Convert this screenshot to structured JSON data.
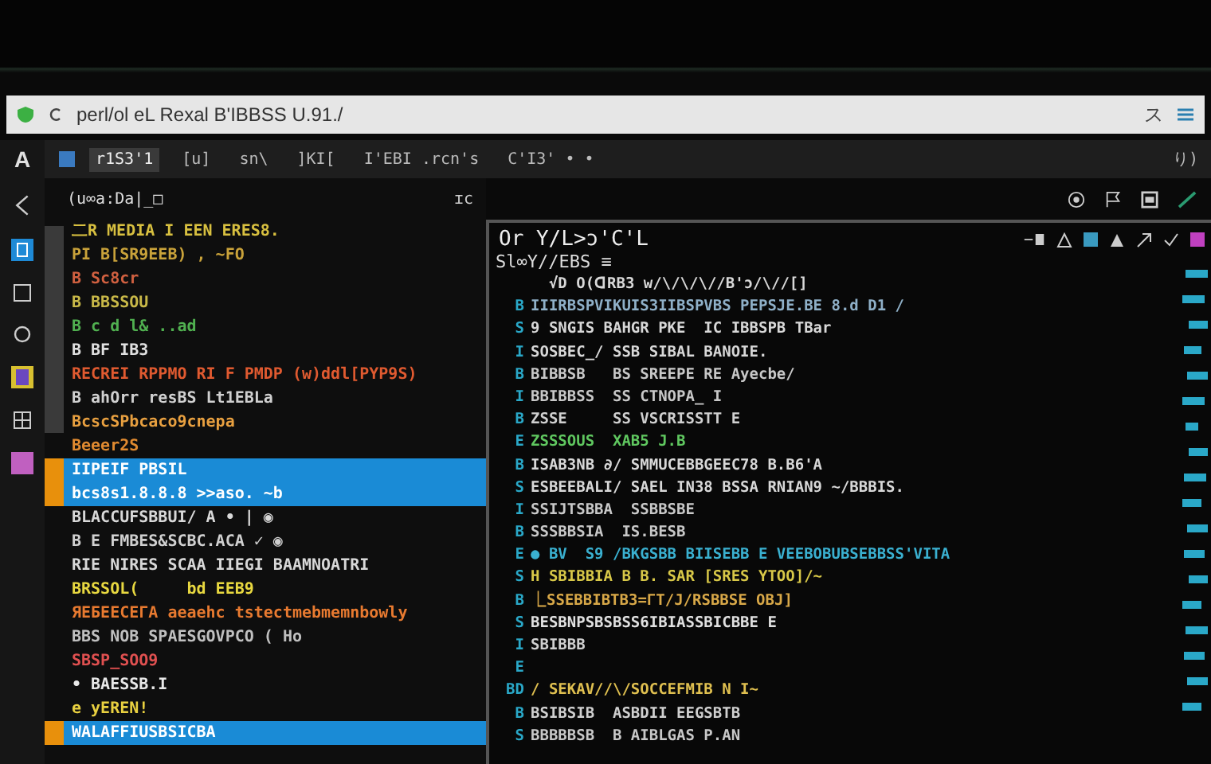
{
  "window": {
    "logo": "A"
  },
  "address_bar": {
    "url": "perl/ol eL Rexal B'IBBSS U.91./",
    "suffix": "ス"
  },
  "toolbar": {
    "items": [
      {
        "label": "r1S3'1",
        "selected": true
      },
      {
        "label": "[u]",
        "selected": false
      },
      {
        "label": "sn\\",
        "selected": false
      },
      {
        "label": "]KI[",
        "selected": false
      },
      {
        "label": "I'EBI .rcn's",
        "selected": false
      },
      {
        "label": "C'I3' • •",
        "selected": false
      }
    ],
    "right": "り)"
  },
  "sidebar": {
    "header": "(u∞a:Da|_□",
    "badge": "ɪc",
    "rows": [
      {
        "text": "二R MEDIA I EEN ERES8.",
        "color": "#d8c040",
        "selected": false
      },
      {
        "text": "PI B[SR9EEB) , ~FO",
        "color": "#c9a23a",
        "selected": false
      },
      {
        "text": "B Sc8cr",
        "color": "#d06040",
        "selected": false
      },
      {
        "text": "B BBSSOU",
        "color": "#c8b848",
        "selected": false
      },
      {
        "text": "B c d l& ..ad",
        "color": "#50b050",
        "selected": false
      },
      {
        "text": "B BF IB3",
        "color": "#e0e0e0",
        "selected": false
      },
      {
        "text": "RECREI RPPMO RI F PMDP (w)ddl[PYP9S)",
        "color": "#e05a30",
        "selected": false
      },
      {
        "text": "B ahOrr resBS Lt1EBLa",
        "color": "#d0d0d0",
        "selected": false
      },
      {
        "text": "BcscSPbcaco9cnepa",
        "color": "#e8a040",
        "selected": false
      },
      {
        "text": "Beeer2S",
        "color": "#e08a30",
        "selected": false
      },
      {
        "text": "IIPEIF PBSIL",
        "selected": true
      },
      {
        "text": "bcs8s1.8.8.8 >>aso. ~b",
        "selected": true
      },
      {
        "text": "BLACCUFSBBUI/ A • | ◉",
        "color": "#d8d8d8",
        "selected": false
      },
      {
        "text": "B E FMBES&SCBC.ACA ✓ ◉",
        "color": "#d0d0d0",
        "selected": false
      },
      {
        "text": "RIE NIRES SCAA IIEGI BAAMNOATRI",
        "color": "#d8d8d8",
        "selected": false
      },
      {
        "text": "BRSSOL(     bd EEB9",
        "color": "#e8d840",
        "selected": false
      },
      {
        "text": "ЯEБEECEГA aeaehc tstectmebmemnbowly",
        "color": "#e87a30",
        "selected": false
      },
      {
        "text": "BBS NOB SPAESGOVPCO ( Ho",
        "color": "#c0c0c0",
        "selected": false
      },
      {
        "text": "SBSP_SOO9",
        "color": "#e05050",
        "selected": false
      },
      {
        "text": "• BAESSB.I",
        "color": "#e8e8e8",
        "selected": false
      },
      {
        "text": "e yEREN!",
        "color": "#e8d040",
        "selected": false
      },
      {
        "text": "WALAFFIUSBSICBA",
        "selected": true
      }
    ]
  },
  "editor": {
    "title": "Or Y/L>ɔ'C'L",
    "subtitle": "Sl∞Y//EBS ≡",
    "lines": [
      {
        "text": "  √D O(ꓷRB3 w/\\/\\/\\//B'ɔ/\\/∕[]",
        "color": "#d8d8d8"
      },
      {
        "gutter": "B",
        "text": "IIIRBSPVIKUIS3IIBSPVBS PEPSJE.BE 8.d D1 ∕",
        "color": "#8fb0c8"
      },
      {
        "gutter": "S",
        "text": "9 SNGIS BAHGR PKE  IC IBBSPB TBar",
        "color": "#d8d8d8"
      },
      {
        "gutter": "I",
        "text": "SOSBEC_/ SSB SIBAL BANOIE.",
        "color": "#d8d8d8"
      },
      {
        "gutter": "B",
        "text": "BIBBSB   BS SREEPE RE Ayecbe/",
        "color": "#c8c8c8"
      },
      {
        "gutter": "I",
        "text": "BBIBBSS  SS CTNOPA_ I",
        "color": "#c8c8c8"
      },
      {
        "gutter": "B",
        "text": "ZSSE     SS VSCRISSTT E",
        "color": "#d0d0d0"
      },
      {
        "gutter": "E",
        "text": "ZSSSOUS  XAB5 J.B",
        "color": "#60c860"
      },
      {
        "gutter": "B",
        "text": "ISAB3NB ∂/ SMMUCEBBGEEC78 B.B6'A",
        "color": "#d8d8d8"
      },
      {
        "gutter": "S",
        "text": "ESBEEBALI/ SAEL IN38 BSSA RNIAN9 ~/BBBIS.",
        "color": "#d8d8d8"
      },
      {
        "gutter": "I",
        "text": "SSIJTSBBA  SSBBSBE",
        "color": "#c8c8c8"
      },
      {
        "gutter": "B",
        "text": "SSSBBSIA  IS.BESB",
        "color": "#c8c8c8"
      },
      {
        "gutter": "E",
        "text": "● BV  S9 /BKGSBB BIISEBB E VEEBOBUBSEBBSS'VITA",
        "color": "#3ab0d0"
      },
      {
        "gutter": "S",
        "text": "H SBIBBIA B B. SAR [SRES YTOO]/~",
        "color": "#d8c848"
      },
      {
        "gutter": "B",
        "text": "⎿SSEBBIBTB3=ΓT/J/RSBBSE OBJ]",
        "color": "#d8a848"
      },
      {
        "gutter": "S",
        "text": "BESBNPSBSBSS6IBIASSBICBBE E",
        "color": "#e0e0e0"
      },
      {
        "gutter": "I",
        "text": "SBIBBB",
        "color": "#d0d0d0"
      },
      {
        "gutter": "E"
      },
      {
        "gutter": "BD",
        "text": "/ SEKAV//\\/SOCCEFMIB N I~",
        "color": "#e0c050"
      },
      {
        "gutter": "B",
        "text": "BSIBSIB  ASBDII EEGSBTB",
        "color": "#d0d0d0"
      },
      {
        "gutter": "S",
        "text": "BBBBBSB  B AIBLGAS P.AN",
        "color": "#c8c8c8"
      }
    ]
  }
}
